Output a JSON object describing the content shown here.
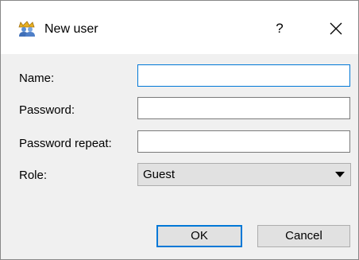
{
  "window": {
    "title": "New user",
    "help_glyph": "?",
    "icon": "users-icon",
    "close_icon": "close-icon"
  },
  "form": {
    "name_label": "Name:",
    "name_value": "",
    "password_label": "Password:",
    "password_value": "",
    "password_repeat_label": "Password repeat:",
    "password_repeat_value": "",
    "role_label": "Role:",
    "role_selected": "Guest"
  },
  "buttons": {
    "ok_label": "OK",
    "cancel_label": "Cancel"
  },
  "colors": {
    "focus_accent": "#0078d7",
    "dialog_background": "#f0f0f0",
    "button_face": "#e1e1e1"
  }
}
